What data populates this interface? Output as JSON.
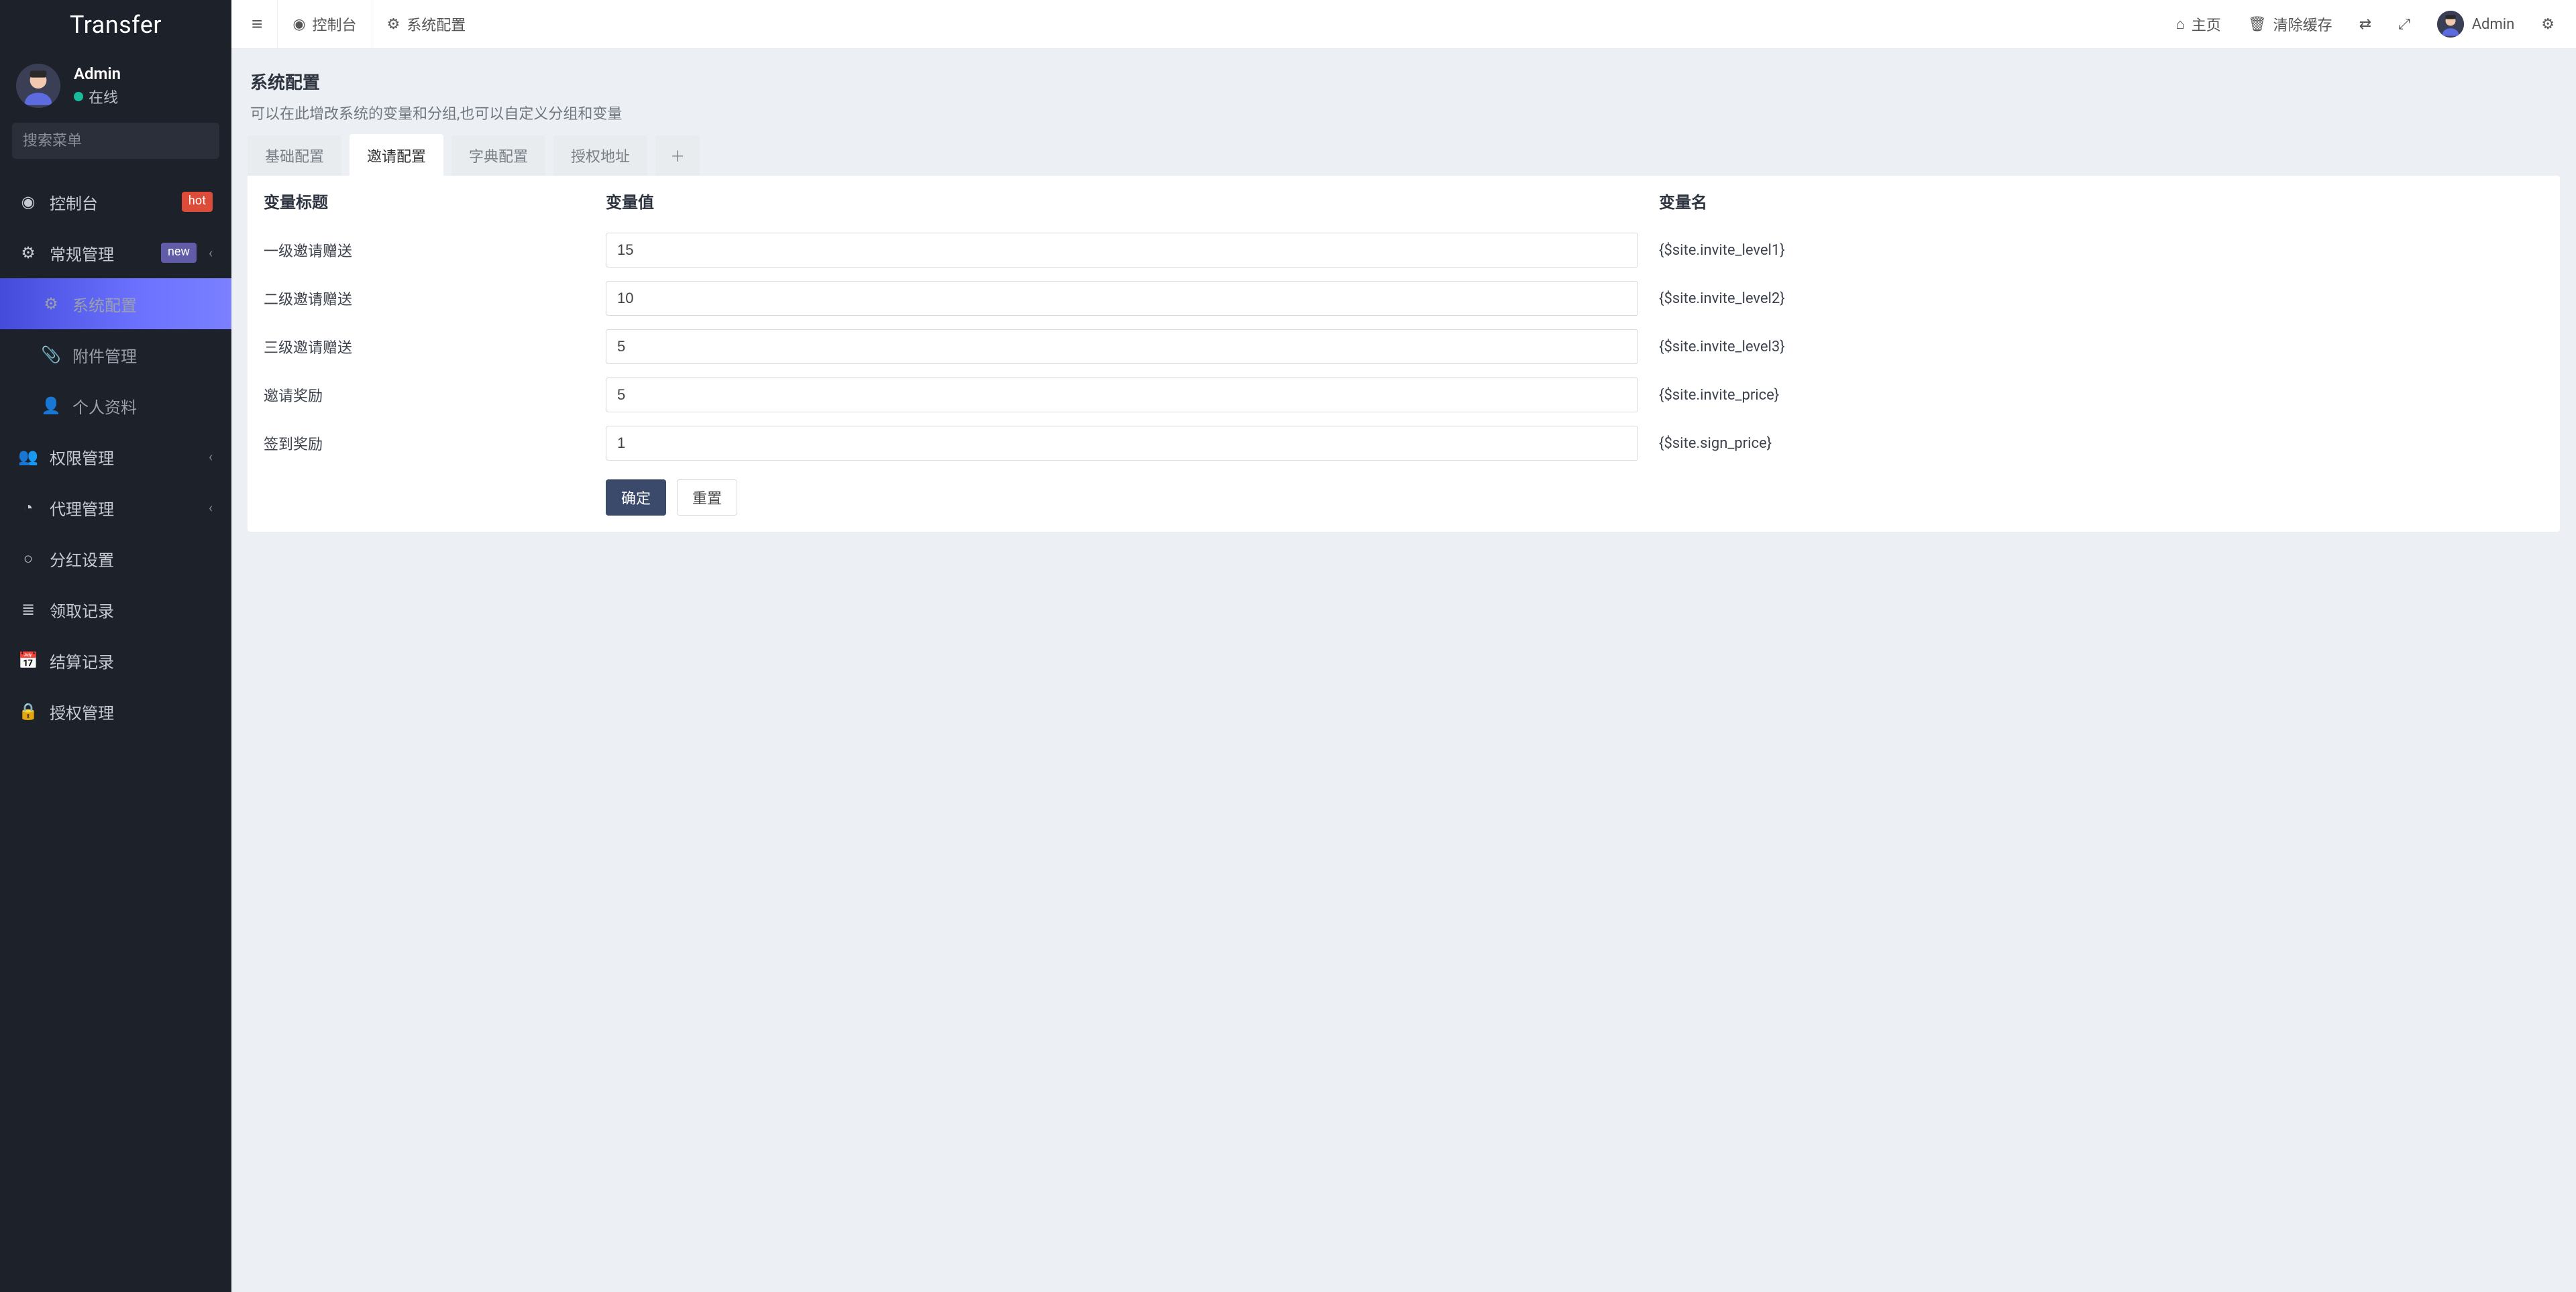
{
  "brand": "Transfer",
  "profile": {
    "name": "Admin",
    "status": "在线"
  },
  "sidebar": {
    "search_placeholder": "搜索菜单",
    "items": [
      {
        "icon": "dashboard",
        "label": "控制台",
        "badge": "hot",
        "badge_kind": "hot"
      },
      {
        "icon": "cogs",
        "label": "常规管理",
        "badge": "new",
        "badge_kind": "new",
        "expandable": true
      },
      {
        "icon": "gear",
        "label": "系统配置",
        "indent": true,
        "active": true
      },
      {
        "icon": "paperclip",
        "label": "附件管理",
        "indent": true
      },
      {
        "icon": "user",
        "label": "个人资料",
        "indent": true
      },
      {
        "icon": "users",
        "label": "权限管理",
        "expandable": true
      },
      {
        "icon": "user-circle",
        "label": "代理管理",
        "expandable": true
      },
      {
        "icon": "circle",
        "label": "分红设置"
      },
      {
        "icon": "bars",
        "label": "领取记录"
      },
      {
        "icon": "calendar",
        "label": "结算记录"
      },
      {
        "icon": "lock",
        "label": "授权管理"
      }
    ]
  },
  "topbar": {
    "tabs": [
      {
        "icon": "dashboard",
        "label": "控制台"
      },
      {
        "icon": "gear",
        "label": "系统配置"
      }
    ],
    "right": {
      "home": "主页",
      "clear_cache": "清除缓存",
      "username": "Admin"
    }
  },
  "page": {
    "title": "系统配置",
    "subtitle": "可以在此增改系统的变量和分组,也可以自定义分组和变量",
    "tabs": [
      "基础配置",
      "邀请配置",
      "字典配置",
      "授权地址"
    ],
    "active_tab_index": 1,
    "columns": {
      "label": "变量标题",
      "value": "变量值",
      "name": "变量名"
    },
    "rows": [
      {
        "label": "一级邀请赠送",
        "value": "15",
        "var": "{$site.invite_level1}"
      },
      {
        "label": "二级邀请赠送",
        "value": "10",
        "var": "{$site.invite_level2}"
      },
      {
        "label": "三级邀请赠送",
        "value": "5",
        "var": "{$site.invite_level3}"
      },
      {
        "label": "邀请奖励",
        "value": "5",
        "var": "{$site.invite_price}"
      },
      {
        "label": "签到奖励",
        "value": "1",
        "var": "{$site.sign_price}"
      }
    ],
    "buttons": {
      "submit": "确定",
      "reset": "重置"
    }
  },
  "icons": {
    "dashboard": "◉",
    "cogs": "⚙",
    "gear": "⚙",
    "paperclip": "📎",
    "user": "👤",
    "users": "👥",
    "user-circle": "◔",
    "circle": "○",
    "bars": "≣",
    "calendar": "📅",
    "lock": "🔒",
    "home": "⌂",
    "trash": "🗑",
    "lang": "⇄",
    "expand": "⤢",
    "sliders": "⚙",
    "add": "＋",
    "chevron": "‹",
    "search": "🔍",
    "hamburger": "≡"
  }
}
